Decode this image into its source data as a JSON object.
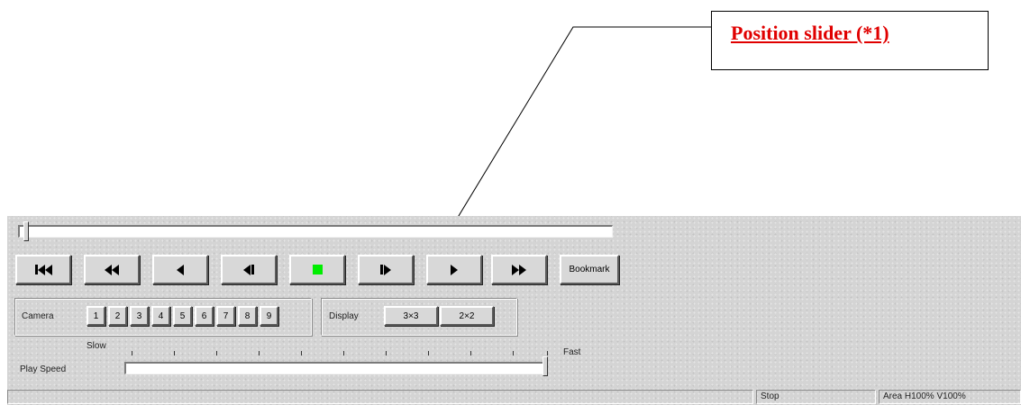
{
  "callout": {
    "text": "Position slider (*1)",
    "color": "#e00000"
  },
  "position_slider": {
    "value": 0.0
  },
  "transport": {
    "buttons": [
      {
        "name": "skip-to-start-button",
        "icon": "skip-to-start-icon"
      },
      {
        "name": "fast-rewind-button",
        "icon": "fast-rewind-icon"
      },
      {
        "name": "reverse-play-button",
        "icon": "reverse-play-icon"
      },
      {
        "name": "step-back-button",
        "icon": "step-back-icon"
      },
      {
        "name": "stop-button",
        "icon": "stop-icon",
        "color": "#00ee00"
      },
      {
        "name": "step-forward-button",
        "icon": "step-forward-icon"
      },
      {
        "name": "play-button",
        "icon": "play-icon"
      },
      {
        "name": "fast-forward-button",
        "icon": "fast-forward-icon"
      }
    ],
    "bookmark_label": "Bookmark"
  },
  "camera": {
    "label": "Camera",
    "buttons": [
      "1",
      "2",
      "3",
      "4",
      "5",
      "6",
      "7",
      "8",
      "9"
    ]
  },
  "display": {
    "label": "Display",
    "buttons": [
      "3×3",
      "2×2"
    ]
  },
  "play_speed": {
    "label": "Play Speed",
    "slow_label": "Slow",
    "fast_label": "Fast",
    "value": 1.0
  },
  "status": {
    "message": "",
    "state": "Stop",
    "area": "Area H100% V100%"
  }
}
